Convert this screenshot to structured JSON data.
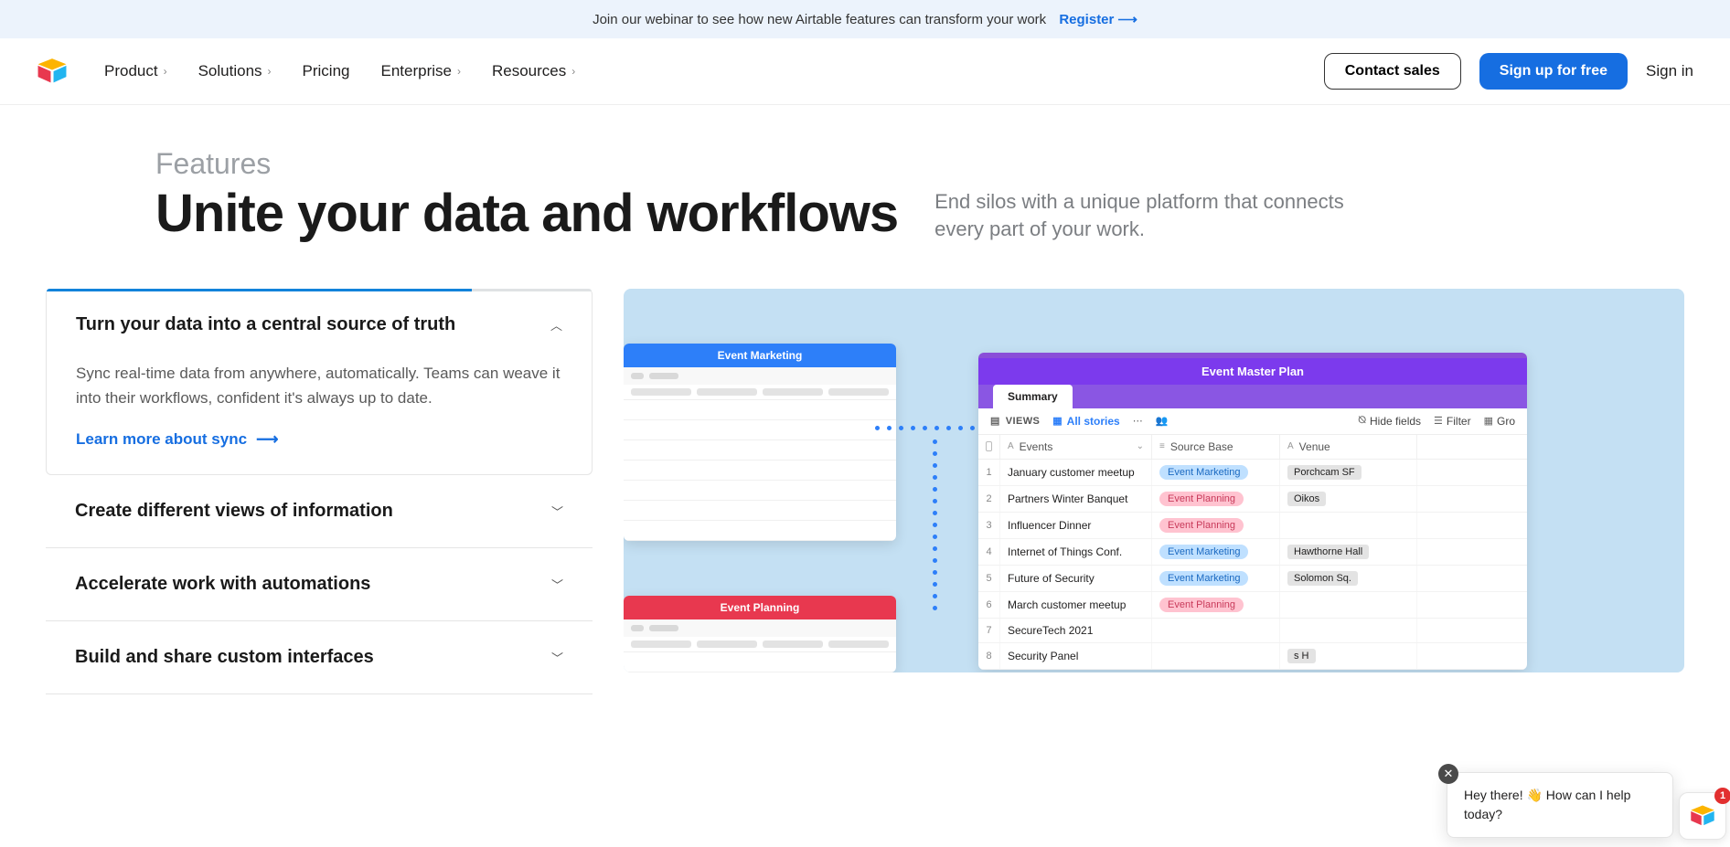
{
  "banner": {
    "text": "Join our webinar to see how new Airtable features can transform your work",
    "link": "Register"
  },
  "nav": {
    "items": [
      "Product",
      "Solutions",
      "Pricing",
      "Enterprise",
      "Resources"
    ],
    "dropdown": [
      true,
      true,
      false,
      true,
      true
    ],
    "contact": "Contact sales",
    "signup": "Sign up for free",
    "signin": "Sign in"
  },
  "hero": {
    "eyebrow": "Features",
    "title": "Unite your data and workflows",
    "subtitle": "End silos with a unique platform that connects every part of your work."
  },
  "accordion": {
    "items": [
      {
        "title": "Turn your data into a central source of truth",
        "desc": "Sync real-time data from anywhere, automatically. Teams can weave it into their workflows, confident it's always up to date.",
        "link": "Learn more about sync"
      },
      {
        "title": "Create different views of information"
      },
      {
        "title": "Accelerate work with automations"
      },
      {
        "title": "Build and share custom interfaces"
      }
    ]
  },
  "visual": {
    "card_em": "Event Marketing",
    "card_ep": "Event Planning",
    "master": {
      "title": "Event Master Plan",
      "tab": "Summary",
      "views": "VIEWS",
      "allstories": "All stories",
      "hide": "Hide fields",
      "filter": "Filter",
      "group": "Gro",
      "cols": [
        "Events",
        "Source Base",
        "Venue"
      ],
      "rows": [
        {
          "n": "1",
          "ev": "January customer meetup",
          "src": "Event Marketing",
          "srcType": "blue",
          "ven": "Porchcam SF"
        },
        {
          "n": "2",
          "ev": "Partners Winter Banquet",
          "src": "Event Planning",
          "srcType": "pink",
          "ven": "Oikos"
        },
        {
          "n": "3",
          "ev": "Influencer Dinner",
          "src": "Event Planning",
          "srcType": "pink",
          "ven": ""
        },
        {
          "n": "4",
          "ev": "Internet of Things Conf.",
          "src": "Event Marketing",
          "srcType": "blue",
          "ven": "Hawthorne Hall"
        },
        {
          "n": "5",
          "ev": "Future of Security",
          "src": "Event Marketing",
          "srcType": "blue",
          "ven": "Solomon Sq."
        },
        {
          "n": "6",
          "ev": "March customer meetup",
          "src": "Event Planning",
          "srcType": "pink",
          "ven": ""
        },
        {
          "n": "7",
          "ev": "SecureTech 2021",
          "src": "",
          "srcType": "",
          "ven": ""
        },
        {
          "n": "8",
          "ev": "Security Panel",
          "src": "",
          "srcType": "",
          "ven": "s H"
        }
      ]
    }
  },
  "chat": {
    "msg": "Hey there! 👋 How can I help today?",
    "badge": "1"
  }
}
